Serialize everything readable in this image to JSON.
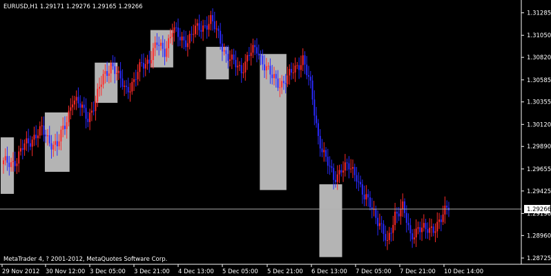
{
  "window": {
    "symbol_header": "EURUSD,H1  1.29171 1.29276 1.29165 1.29266",
    "copyright": "MetaTrader 4, ? 2001-2012, MetaQuotes Software Corp."
  },
  "colors": {
    "background": "#000000",
    "bull": "#ff2a2a",
    "bear": "#2a2aff",
    "highlight": "#b4b4b4",
    "text": "#ffffff",
    "price_line": "#c0c0c0"
  },
  "chart_data": {
    "type": "candlestick",
    "ylim": [
      1.2866,
      1.3139
    ],
    "y_ticks": [
      "1.31285",
      "1.31050",
      "1.30820",
      "1.30585",
      "1.30355",
      "1.30120",
      "1.29890",
      "1.29655",
      "1.29425",
      "1.29190",
      "1.28960",
      "1.28725"
    ],
    "x_ticks": [
      "29 Nov 2012",
      "30 Nov 12:00",
      "3 Dec 05:00",
      "3 Dec 21:00",
      "4 Dec 13:00",
      "5 Dec 05:00",
      "5 Dec 21:00",
      "6 Dec 13:00",
      "7 Dec 05:00",
      "7 Dec 21:00",
      "10 Dec 14:00"
    ],
    "current_price": "1.29266",
    "anchors": [
      [
        0,
        1.2971
      ],
      [
        7,
        1.2975
      ],
      [
        11,
        1.299
      ],
      [
        16,
        1.3
      ],
      [
        20,
        1.3005
      ],
      [
        24,
        1.2995
      ],
      [
        28,
        1.299
      ],
      [
        32,
        1.301
      ],
      [
        36,
        1.304
      ],
      [
        40,
        1.303
      ],
      [
        44,
        1.302
      ],
      [
        48,
        1.3035
      ],
      [
        52,
        1.3062
      ],
      [
        56,
        1.3075
      ],
      [
        60,
        1.306
      ],
      [
        64,
        1.305
      ],
      [
        68,
        1.3055
      ],
      [
        72,
        1.3075
      ],
      [
        76,
        1.308
      ],
      [
        80,
        1.3095
      ],
      [
        84,
        1.309
      ],
      [
        88,
        1.311
      ],
      [
        92,
        1.3102
      ],
      [
        96,
        1.31
      ],
      [
        100,
        1.311
      ],
      [
        104,
        1.3115
      ],
      [
        108,
        1.312
      ],
      [
        112,
        1.3105
      ],
      [
        116,
        1.3085
      ],
      [
        120,
        1.3075
      ],
      [
        124,
        1.307
      ],
      [
        128,
        1.3085
      ],
      [
        132,
        1.309
      ],
      [
        136,
        1.3075
      ],
      [
        140,
        1.306
      ],
      [
        144,
        1.3055
      ],
      [
        148,
        1.306
      ],
      [
        152,
        1.307
      ],
      [
        156,
        1.3082
      ],
      [
        160,
        1.305
      ],
      [
        164,
        1.3
      ],
      [
        168,
        1.2975
      ],
      [
        172,
        1.2955
      ],
      [
        176,
        1.2967
      ],
      [
        180,
        1.2966
      ],
      [
        184,
        1.296
      ],
      [
        188,
        1.2935
      ],
      [
        192,
        1.2925
      ],
      [
        196,
        1.291
      ],
      [
        200,
        1.2885
      ],
      [
        204,
        1.292
      ],
      [
        208,
        1.2925
      ],
      [
        212,
        1.2895
      ],
      [
        216,
        1.2905
      ],
      [
        220,
        1.29
      ],
      [
        224,
        1.2905
      ],
      [
        228,
        1.2912
      ],
      [
        232,
        1.2927
      ]
    ],
    "highlight_bars": [
      [
        0,
        4
      ],
      [
        23,
        33
      ],
      [
        49,
        58
      ],
      [
        78,
        87
      ],
      [
        107,
        116
      ],
      [
        135,
        146
      ],
      [
        166,
        175
      ]
    ],
    "highlight_spans": [
      [
        1.29395,
        1.29985
      ],
      [
        1.29625,
        1.30245
      ],
      [
        1.30345,
        1.30765
      ],
      [
        1.30715,
        1.31105
      ],
      [
        1.3059,
        1.3093
      ],
      [
        1.29435,
        1.30855
      ],
      [
        1.28735,
        1.29495
      ]
    ]
  }
}
